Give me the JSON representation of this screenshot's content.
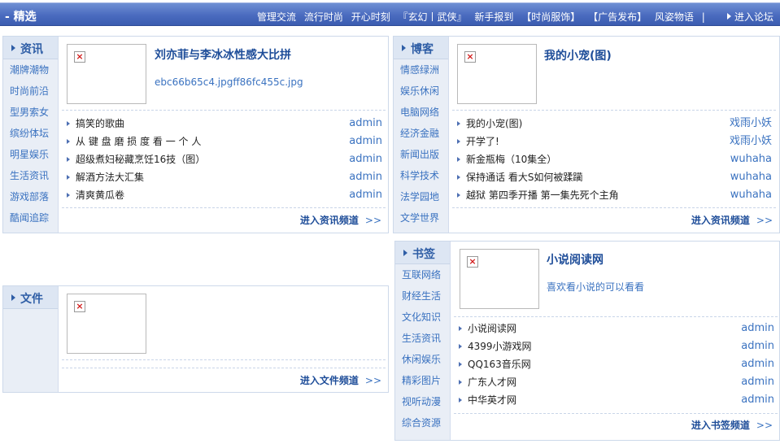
{
  "topbar": {
    "title": "- 精选",
    "links": [
      "管理交流",
      "流行时尚",
      "开心时刻",
      "『玄幻丨武侠』",
      "新手报到",
      "【时尚服饰】",
      "【广告发布】",
      "风姿物语",
      "|"
    ],
    "enter_forum": "进入论坛"
  },
  "panels": {
    "news": {
      "heading": "资讯",
      "categories": [
        "潮牌潮物",
        "时尚前沿",
        "型男索女",
        "缤纷体坛",
        "明星娱乐",
        "生活资讯",
        "游戏部落",
        "酷闻追踪"
      ],
      "headline": "刘亦菲与李冰冰性感大比拼",
      "desc": "ebc66b65c4.jpgff86fc455c.jpg",
      "items": [
        {
          "title": "搞笑的歌曲",
          "author": "admin"
        },
        {
          "title": "从 键 盘 磨 损 度 看 一 个 人",
          "author": "admin"
        },
        {
          "title": "超级煮妇秘藏烹饪16技（图）",
          "author": "admin"
        },
        {
          "title": "解酒方法大汇集",
          "author": "admin"
        },
        {
          "title": "清爽黄瓜卷",
          "author": "admin"
        }
      ],
      "more": "进入资讯频道",
      "more_arrow": ">>"
    },
    "blog": {
      "heading": "博客",
      "categories": [
        "情感绿洲",
        "娱乐休闲",
        "电脑网络",
        "经济金融",
        "新闻出版",
        "科学技术",
        "法学园地",
        "文学世界"
      ],
      "headline": "我的小宠(图)",
      "items": [
        {
          "title": "我的小宠(图)",
          "author": "戏雨小妖"
        },
        {
          "title": "开学了!",
          "author": "戏雨小妖"
        },
        {
          "title": "新金瓶梅（10集全）",
          "author": "wuhaha"
        },
        {
          "title": "保持通话 看大S如何被蹂躏",
          "author": "wuhaha"
        },
        {
          "title": "越狱 第四季开播 第一集先死个主角",
          "author": "wuhaha"
        }
      ],
      "more": "进入资讯频道",
      "more_arrow": ">>"
    },
    "files": {
      "heading": "文件",
      "more": "进入文件频道",
      "more_arrow": ">>"
    },
    "bookmarks": {
      "heading": "书签",
      "categories": [
        "互联网络",
        "财经生活",
        "文化知识",
        "生活资讯",
        "休闲娱乐",
        "精彩图片",
        "视听动漫",
        "综合资源"
      ],
      "headline": "小说阅读网",
      "desc": "喜欢看小说的可以看看",
      "items": [
        {
          "title": "小说阅读网",
          "author": "admin"
        },
        {
          "title": "4399小游戏网",
          "author": "admin"
        },
        {
          "title": "QQ163音乐网",
          "author": "admin"
        },
        {
          "title": "广东人才网",
          "author": "admin"
        },
        {
          "title": "中华英才网",
          "author": "admin"
        }
      ],
      "more": "进入书签频道",
      "more_arrow": ">>"
    }
  },
  "broken_image_glyph": "×"
}
